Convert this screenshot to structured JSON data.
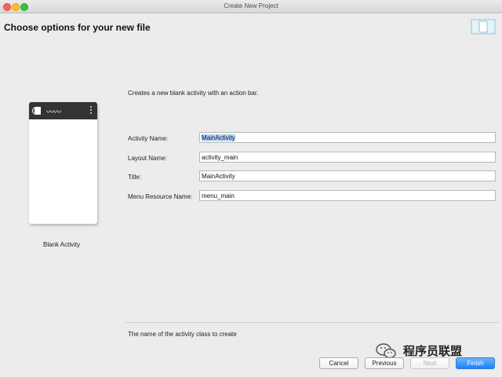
{
  "window": {
    "title": "Create New Project"
  },
  "header": {
    "heading": "Choose options for your new file"
  },
  "template": {
    "label": "Blank Activity"
  },
  "description": "Creates a new blank activity with an action bar.",
  "form": {
    "activity_name": {
      "label": "Activity Name:",
      "value": "MainActivity"
    },
    "layout_name": {
      "label": "Layout Name:",
      "value": "activity_main"
    },
    "title": {
      "label": "Title:",
      "value": "MainActivity"
    },
    "menu_resource_name": {
      "label": "Menu Resource Name:",
      "value": "menu_main"
    }
  },
  "hint": "The name of the activity class to create",
  "buttons": {
    "cancel": "Cancel",
    "previous": "Previous",
    "next": "Next",
    "finish": "Finish"
  },
  "watermark": {
    "text": "程序员联盟"
  },
  "colors": {
    "primary_button": "#1a82fb",
    "selection": "#b3d4fd",
    "close": "#fc5f57",
    "minimize": "#fdbc2e",
    "zoom": "#2bc840"
  },
  "icons": [
    "close-icon",
    "minimize-icon",
    "zoom-icon",
    "device-layout-icon",
    "wechat-icon"
  ]
}
